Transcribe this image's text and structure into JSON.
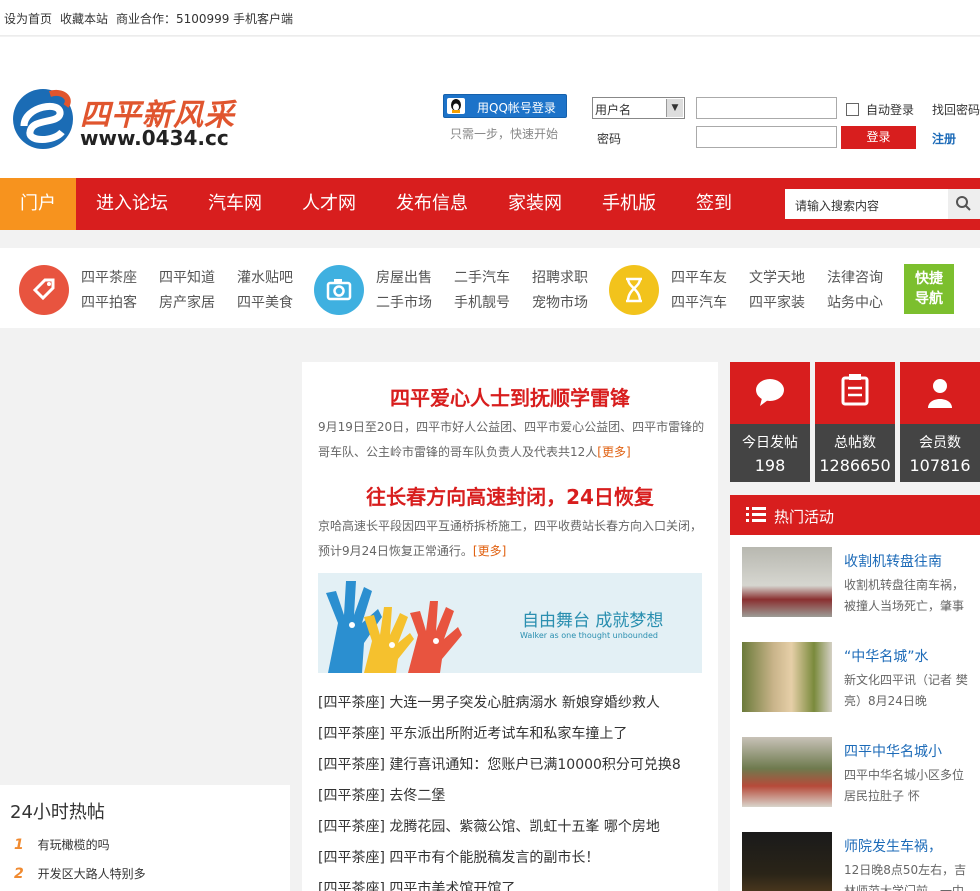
{
  "topbar": {
    "links": [
      "设为首页",
      "收藏本站",
      "商业合作：5100999",
      "手机客户端"
    ]
  },
  "logo": {
    "name": "四平新风采",
    "url": "www.0434.cc"
  },
  "login": {
    "qq_button": "用QQ帐号登录",
    "qq_tip": "只需一步，快速开始",
    "username_select": "用户名",
    "password_label": "密码",
    "auto_login": "自动登录",
    "login_button": "登录",
    "find_password": "找回密码",
    "register": "注册"
  },
  "nav": {
    "items": [
      "门户",
      "进入论坛",
      "汽车网",
      "人才网",
      "发布信息",
      "家装网",
      "手机版",
      "签到"
    ],
    "active": "门户",
    "search_placeholder": "请输入搜索内容"
  },
  "quick": {
    "group1": [
      "四平茶座",
      "四平知道",
      "灌水贴吧",
      "四平拍客",
      "房产家居",
      "四平美食"
    ],
    "group2": [
      "房屋出售",
      "二手汽车",
      "招聘求职",
      "二手市场",
      "手机靓号",
      "宠物市场"
    ],
    "group3": [
      "四平车友",
      "文学天地",
      "法律咨询",
      "四平汽车",
      "四平家装",
      "站务中心"
    ],
    "nav_button": [
      "快捷",
      "导航"
    ]
  },
  "hot_posts": {
    "title": "24小时热帖",
    "items": [
      {
        "num": "1",
        "title": "有玩橄榄的吗"
      },
      {
        "num": "2",
        "title": "开发区大路人特别多"
      }
    ]
  },
  "center": {
    "headline1": "四平爱心人士到抚顺学雷锋",
    "summary1": "9月19日至20日，四平市好人公益团、四平市爱心公益团、四平市雷锋的哥车队、公主岭市雷锋的哥车队负责人及代表共12人",
    "headline2": "往长春方向高速封闭，24日恢复",
    "summary2": "京哈高速长平段因四平互通桥拆桥施工，四平收费站长春方向入口关闭，预计9月24日恢复正常通行。",
    "more": "[更多]",
    "banner_title": "自由舞台  成就梦想",
    "banner_subtitle": "Walker as one thought unbounded",
    "posts": [
      "[四平茶座]  大连一男子突发心脏病溺水 新娘穿婚纱救人",
      "[四平茶座]  平东派出所附近考试车和私家车撞上了",
      "[四平茶座]  建行喜讯通知：您账户已满10000积分可兑换8",
      "[四平茶座]  去佟二堡",
      "[四平茶座]  龙腾花园、紫薇公馆、凯虹十五峯 哪个房地",
      "[四平茶座]  四平市有个能脱稿发言的副市长！",
      "[四平茶座]  四平市美术馆开馆了"
    ]
  },
  "stats": [
    {
      "label": "今日发帖",
      "value": "198"
    },
    {
      "label": "总帖数",
      "value": "1286650"
    },
    {
      "label": "会员数",
      "value": "107816"
    }
  ],
  "activities": {
    "title": "热门活动",
    "items": [
      {
        "title": "收割机转盘往南",
        "desc": "收割机转盘往南车祸，被撞人当场死亡，肇事"
      },
      {
        "title": "“中华名城”水",
        "desc": "新文化四平讯（记者 樊亮）8月24日晚"
      },
      {
        "title": "四平中华名城小",
        "desc": "四平中华名城小区多位居民拉肚子 怀"
      },
      {
        "title": "师院发生车祸，",
        "desc": "12日晚8点50左右，吉林师范大学门前，一中"
      }
    ]
  }
}
